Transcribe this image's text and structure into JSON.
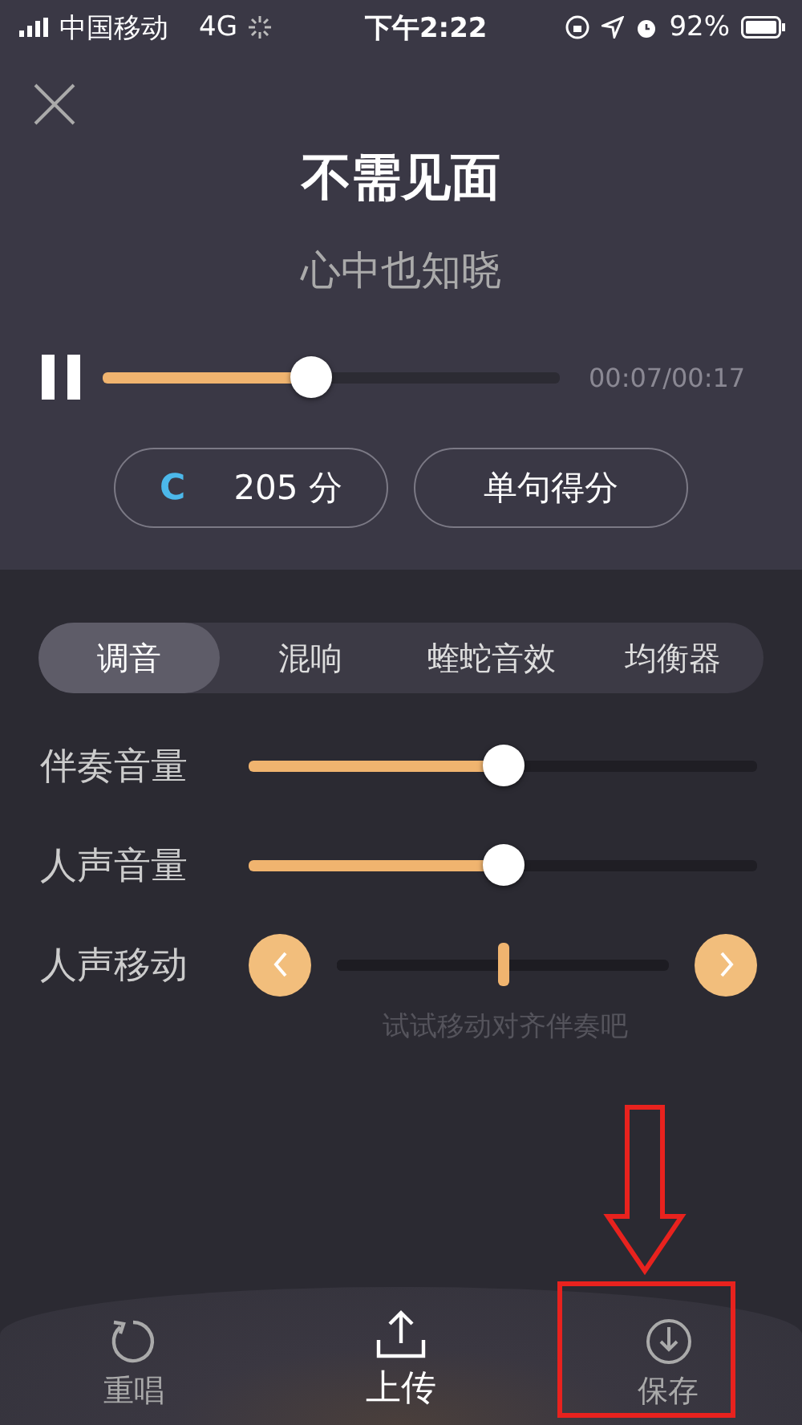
{
  "status_bar": {
    "carrier": "中国移动",
    "network": "4G",
    "time": "下午2:22",
    "battery": "92%"
  },
  "song": {
    "title": "不需见面",
    "lyric": "心中也知晓",
    "playing": true,
    "level": 0.456,
    "time": "00:07/00:17"
  },
  "score": {
    "grade": "C",
    "points": "205 分",
    "button": "单句得分"
  },
  "tabs": [
    {
      "label": "调音",
      "selected": true
    },
    {
      "label": "混响",
      "selected": false
    },
    {
      "label": "蝰蛇音效",
      "selected": false
    },
    {
      "label": "均衡器",
      "selected": false
    }
  ],
  "controls": [
    {
      "kind": "slider",
      "label": "伴奏音量",
      "level": 0.5
    },
    {
      "kind": "slider",
      "label": "人声音量",
      "level": 0.5
    },
    {
      "kind": "shift",
      "label": "人声移动",
      "level": 0.5,
      "hint": "试试移动对齐伴奏吧"
    }
  ],
  "bottom_bar": [
    {
      "kind": "redo",
      "label": "重唱",
      "highlighted": false
    },
    {
      "kind": "upload",
      "label": "上传",
      "highlighted": true
    },
    {
      "kind": "save",
      "label": "保存",
      "highlighted": false
    }
  ]
}
